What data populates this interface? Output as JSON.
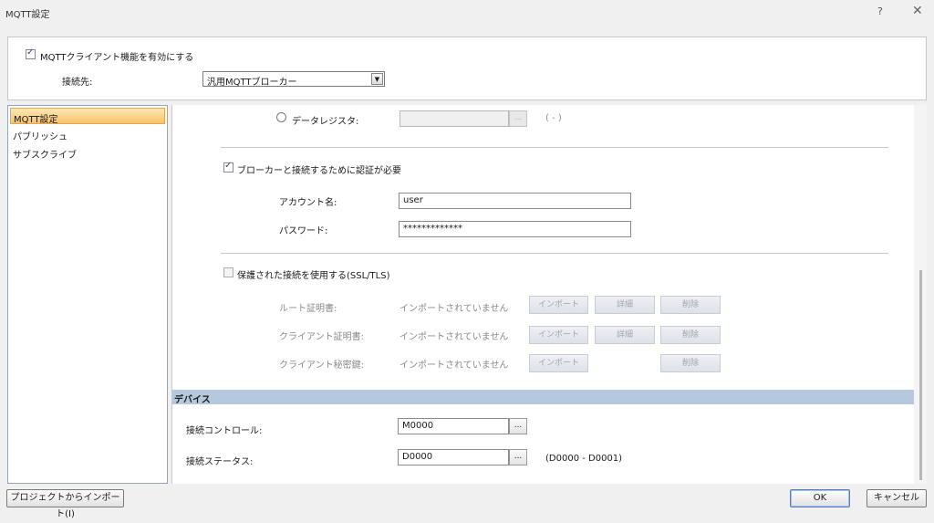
{
  "window": {
    "title": "MQTT設定",
    "help": "?",
    "close": "✕"
  },
  "top": {
    "enable_label": "MQTTクライアント機能を有効にする",
    "dest_label": "接続先:",
    "dest_value": "汎用MQTTブローカー"
  },
  "sidebar": {
    "items": [
      {
        "label": "MQTT設定"
      },
      {
        "label": "パブリッシュ"
      },
      {
        "label": "サブスクライブ"
      }
    ]
  },
  "content": {
    "data_register_label": "データレジスタ:",
    "data_register_range": "( - )",
    "dots": "...",
    "auth_label": "ブローカーと接続するために認証が必要",
    "account_label": "アカウント名:",
    "account_value": "user",
    "password_label": "パスワード:",
    "password_value": "*************",
    "ssl_label": "保護された接続を使用する(SSL/TLS)",
    "certs": [
      {
        "label": "ルート証明書:",
        "status": "インポートされていません"
      },
      {
        "label": "クライアント証明書:",
        "status": "インポートされていません"
      },
      {
        "label": "クライアント秘密鍵:",
        "status": "インポートされていません"
      }
    ],
    "import_btn": "インポート",
    "detail_btn": "詳細",
    "delete_btn": "削除"
  },
  "device": {
    "header": "デバイス",
    "control_label": "接続コントロール:",
    "control_value": "M0000",
    "status_label": "接続ステータス:",
    "status_value": "D0000",
    "status_range": "(D0000 - D0001)"
  },
  "footer": {
    "import_project": "プロジェクトからインポート(I)",
    "ok": "OK",
    "cancel": "キャンセル"
  }
}
